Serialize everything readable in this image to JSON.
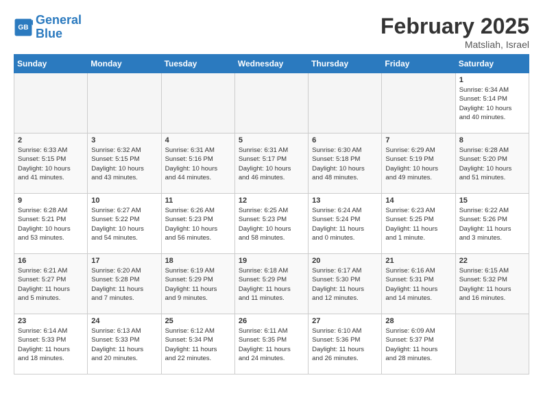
{
  "header": {
    "logo_line1": "General",
    "logo_line2": "Blue",
    "month": "February 2025",
    "location": "Matsliah, Israel"
  },
  "days_of_week": [
    "Sunday",
    "Monday",
    "Tuesday",
    "Wednesday",
    "Thursday",
    "Friday",
    "Saturday"
  ],
  "weeks": [
    [
      {
        "day": "",
        "info": ""
      },
      {
        "day": "",
        "info": ""
      },
      {
        "day": "",
        "info": ""
      },
      {
        "day": "",
        "info": ""
      },
      {
        "day": "",
        "info": ""
      },
      {
        "day": "",
        "info": ""
      },
      {
        "day": "1",
        "info": "Sunrise: 6:34 AM\nSunset: 5:14 PM\nDaylight: 10 hours\nand 40 minutes."
      }
    ],
    [
      {
        "day": "2",
        "info": "Sunrise: 6:33 AM\nSunset: 5:15 PM\nDaylight: 10 hours\nand 41 minutes."
      },
      {
        "day": "3",
        "info": "Sunrise: 6:32 AM\nSunset: 5:15 PM\nDaylight: 10 hours\nand 43 minutes."
      },
      {
        "day": "4",
        "info": "Sunrise: 6:31 AM\nSunset: 5:16 PM\nDaylight: 10 hours\nand 44 minutes."
      },
      {
        "day": "5",
        "info": "Sunrise: 6:31 AM\nSunset: 5:17 PM\nDaylight: 10 hours\nand 46 minutes."
      },
      {
        "day": "6",
        "info": "Sunrise: 6:30 AM\nSunset: 5:18 PM\nDaylight: 10 hours\nand 48 minutes."
      },
      {
        "day": "7",
        "info": "Sunrise: 6:29 AM\nSunset: 5:19 PM\nDaylight: 10 hours\nand 49 minutes."
      },
      {
        "day": "8",
        "info": "Sunrise: 6:28 AM\nSunset: 5:20 PM\nDaylight: 10 hours\nand 51 minutes."
      }
    ],
    [
      {
        "day": "9",
        "info": "Sunrise: 6:28 AM\nSunset: 5:21 PM\nDaylight: 10 hours\nand 53 minutes."
      },
      {
        "day": "10",
        "info": "Sunrise: 6:27 AM\nSunset: 5:22 PM\nDaylight: 10 hours\nand 54 minutes."
      },
      {
        "day": "11",
        "info": "Sunrise: 6:26 AM\nSunset: 5:23 PM\nDaylight: 10 hours\nand 56 minutes."
      },
      {
        "day": "12",
        "info": "Sunrise: 6:25 AM\nSunset: 5:23 PM\nDaylight: 10 hours\nand 58 minutes."
      },
      {
        "day": "13",
        "info": "Sunrise: 6:24 AM\nSunset: 5:24 PM\nDaylight: 11 hours\nand 0 minutes."
      },
      {
        "day": "14",
        "info": "Sunrise: 6:23 AM\nSunset: 5:25 PM\nDaylight: 11 hours\nand 1 minute."
      },
      {
        "day": "15",
        "info": "Sunrise: 6:22 AM\nSunset: 5:26 PM\nDaylight: 11 hours\nand 3 minutes."
      }
    ],
    [
      {
        "day": "16",
        "info": "Sunrise: 6:21 AM\nSunset: 5:27 PM\nDaylight: 11 hours\nand 5 minutes."
      },
      {
        "day": "17",
        "info": "Sunrise: 6:20 AM\nSunset: 5:28 PM\nDaylight: 11 hours\nand 7 minutes."
      },
      {
        "day": "18",
        "info": "Sunrise: 6:19 AM\nSunset: 5:29 PM\nDaylight: 11 hours\nand 9 minutes."
      },
      {
        "day": "19",
        "info": "Sunrise: 6:18 AM\nSunset: 5:29 PM\nDaylight: 11 hours\nand 11 minutes."
      },
      {
        "day": "20",
        "info": "Sunrise: 6:17 AM\nSunset: 5:30 PM\nDaylight: 11 hours\nand 12 minutes."
      },
      {
        "day": "21",
        "info": "Sunrise: 6:16 AM\nSunset: 5:31 PM\nDaylight: 11 hours\nand 14 minutes."
      },
      {
        "day": "22",
        "info": "Sunrise: 6:15 AM\nSunset: 5:32 PM\nDaylight: 11 hours\nand 16 minutes."
      }
    ],
    [
      {
        "day": "23",
        "info": "Sunrise: 6:14 AM\nSunset: 5:33 PM\nDaylight: 11 hours\nand 18 minutes."
      },
      {
        "day": "24",
        "info": "Sunrise: 6:13 AM\nSunset: 5:33 PM\nDaylight: 11 hours\nand 20 minutes."
      },
      {
        "day": "25",
        "info": "Sunrise: 6:12 AM\nSunset: 5:34 PM\nDaylight: 11 hours\nand 22 minutes."
      },
      {
        "day": "26",
        "info": "Sunrise: 6:11 AM\nSunset: 5:35 PM\nDaylight: 11 hours\nand 24 minutes."
      },
      {
        "day": "27",
        "info": "Sunrise: 6:10 AM\nSunset: 5:36 PM\nDaylight: 11 hours\nand 26 minutes."
      },
      {
        "day": "28",
        "info": "Sunrise: 6:09 AM\nSunset: 5:37 PM\nDaylight: 11 hours\nand 28 minutes."
      },
      {
        "day": "",
        "info": ""
      }
    ]
  ]
}
